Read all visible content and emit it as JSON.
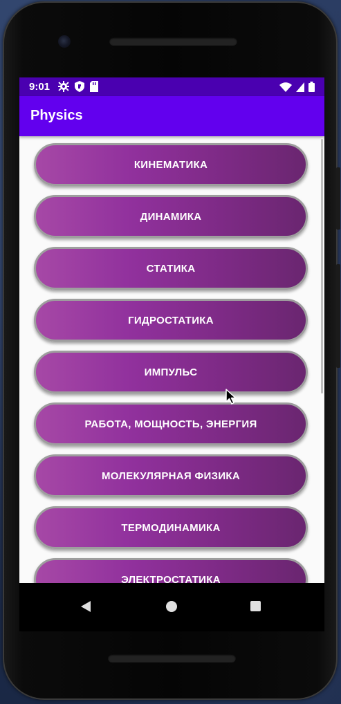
{
  "status_bar": {
    "time": "9:01",
    "left_icons": [
      "gear-icon",
      "shield-icon",
      "sd-card-icon"
    ],
    "right_icons": [
      "wifi-icon",
      "signal-icon",
      "battery-icon"
    ]
  },
  "app_bar": {
    "title": "Physics"
  },
  "topics": [
    "КИНЕМАТИКА",
    "ДИНАМИКА",
    "СТАТИКА",
    "ГИДРОСТАТИКА",
    "ИМПУЛЬС",
    "РАБОТА, МОЩНОСТЬ, ЭНЕРГИЯ",
    "МОЛЕКУЛЯРНАЯ ФИЗИКА",
    "ТЕРМОДИНАМИКА",
    "ЭЛЕКТРОСТАТИКА"
  ],
  "nav_bar": {
    "icons": [
      "back-icon",
      "home-icon",
      "recents-icon"
    ]
  },
  "colors": {
    "status_bar": "#4a00b0",
    "app_bar": "#6200ee",
    "button_gradient_start": "#a648a6",
    "button_gradient_end": "#6a2670",
    "button_border": "#9e9e9e",
    "content_bg": "#fafafa"
  }
}
